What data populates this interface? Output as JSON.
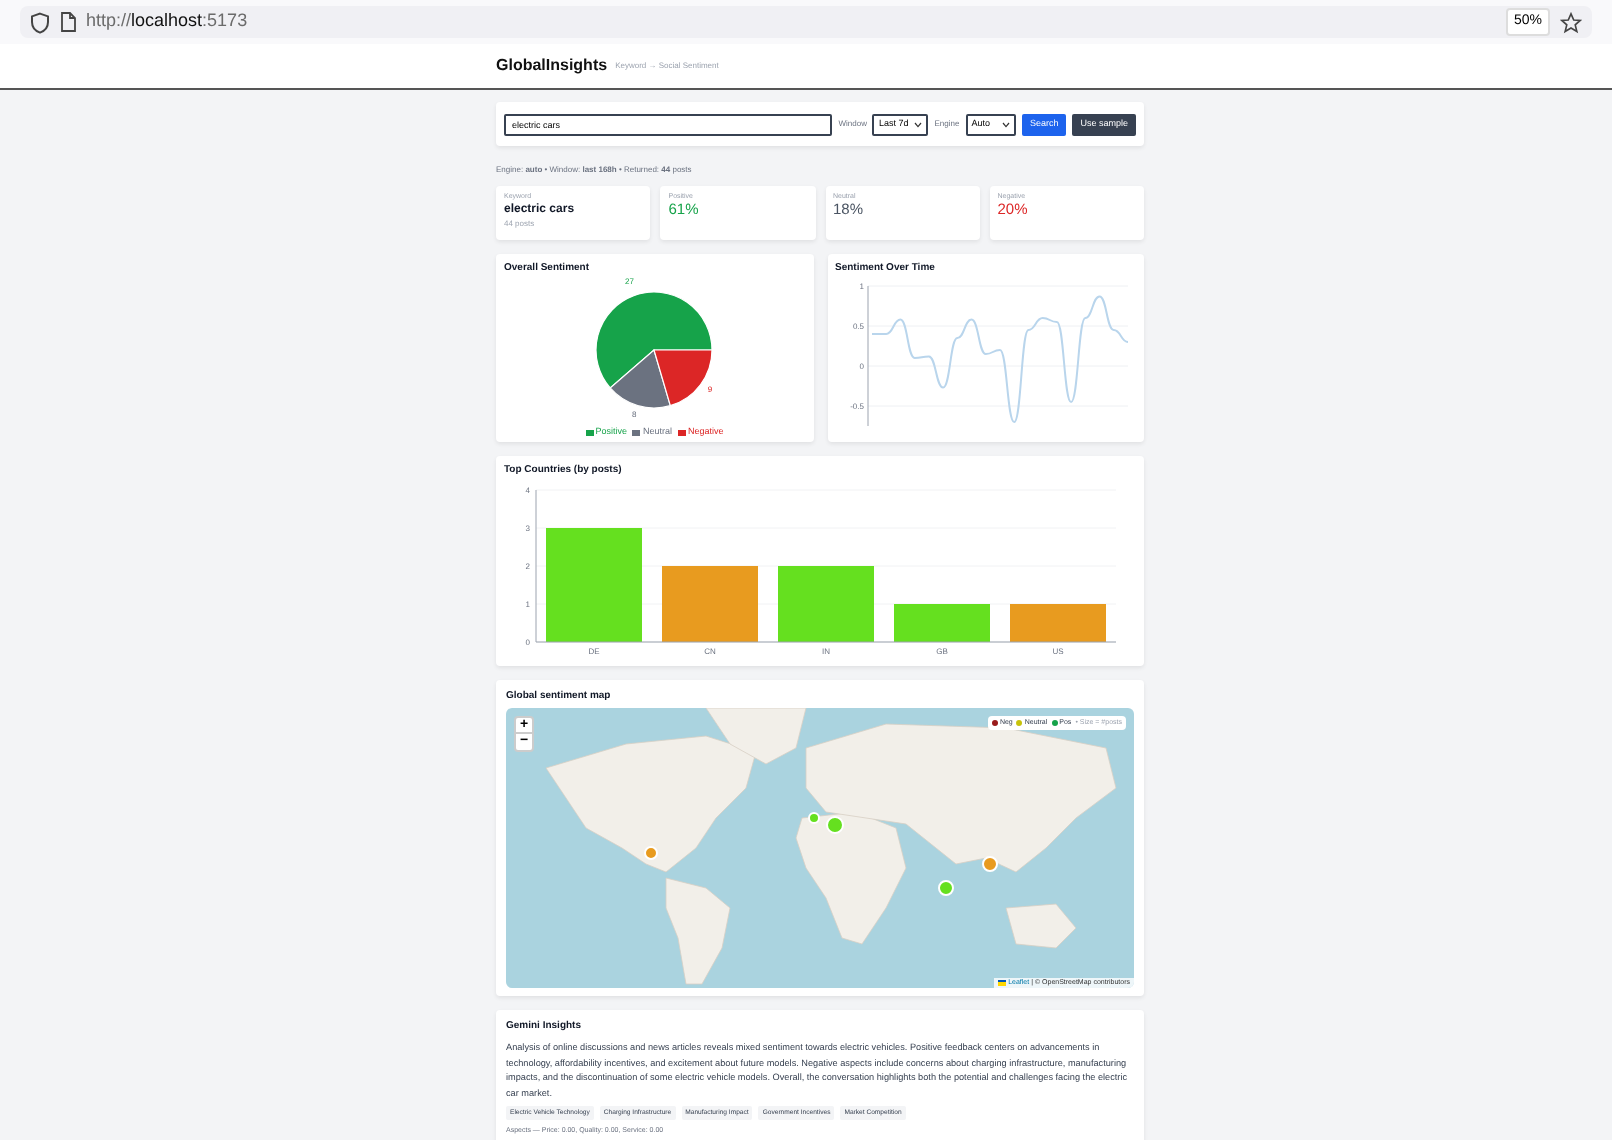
{
  "browser": {
    "url_scheme": "http://",
    "url_host": "localhost",
    "url_port": ":5173",
    "zoom": "50%"
  },
  "header": {
    "brand": "GlobalInsights",
    "tagline": "Keyword → Social Sentiment"
  },
  "search": {
    "value": "electric cars",
    "window_label": "Window",
    "window_value": "Last 7d",
    "engine_label": "Engine",
    "engine_value": "Auto",
    "buttons": [
      {
        "label": "Search",
        "kind": "primary"
      },
      {
        "label": "Use sample",
        "kind": "secondary"
      }
    ]
  },
  "summary": "Engine: **auto** • Window: **last 168h** • Returned: **44** posts",
  "stats": [
    {
      "label": "Keyword",
      "value": "electric cars",
      "note": "44 posts",
      "color": "#111827"
    },
    {
      "label": "Positive",
      "value": "61%",
      "color": "#16a34a"
    },
    {
      "label": "Neutral",
      "value": "18%",
      "color": "#4b5563"
    },
    {
      "label": "Negative",
      "value": "20%",
      "color": "#dc2626"
    }
  ],
  "overall": {
    "title": "Overall Sentiment",
    "chart_data": {
      "type": "pie",
      "categories": [
        "Positive",
        "Neutral",
        "Negative"
      ],
      "colors": [
        "#16a34a",
        "#6b7280",
        "#dc2626"
      ],
      "values": [
        27,
        8,
        9
      ],
      "data_labels": true,
      "legend": true
    }
  },
  "over_time": {
    "title": "Sentiment Over Time",
    "chart_data": {
      "type": "line",
      "ylim": [
        -0.75,
        1
      ],
      "yticks": [
        -0.5,
        0,
        0.5,
        1
      ],
      "grid": true,
      "series": [
        {
          "color": "#b9d5ec",
          "values": [
            0.4,
            0.4,
            0.58,
            0.1,
            0.12,
            -0.27,
            0.35,
            0.58,
            0.15,
            0.2,
            -0.7,
            0.45,
            0.6,
            0.55,
            -0.45,
            0.6,
            0.87,
            0.45,
            0.3
          ]
        }
      ]
    }
  },
  "countries": {
    "title": "Top Countries (by posts)",
    "chart_data": {
      "type": "bar",
      "categories": [
        "DE",
        "CN",
        "IN",
        "GB",
        "US"
      ],
      "ylim": [
        0,
        4
      ],
      "yticks": [
        0,
        1,
        2,
        3,
        4
      ],
      "grid": true,
      "stacked": true,
      "series": [
        {
          "color": "#65e01f",
          "values": [
            3,
            null,
            2,
            1,
            null
          ]
        },
        {
          "color": "#e89b1f",
          "values": [
            null,
            2,
            null,
            null,
            1
          ]
        }
      ]
    }
  },
  "map": {
    "title": "Global sentiment map",
    "zoom_in": "+",
    "zoom_out": "−",
    "legend": [
      {
        "label": "Neg",
        "color": "#991b1b"
      },
      {
        "label": "Neutral",
        "color": "#c7c20a"
      },
      {
        "label": "Pos",
        "color": "#16a34a"
      }
    ],
    "legend_note": "• Size = #posts",
    "markers": [
      {
        "color": "#e89b1f"
      },
      {
        "color": "#65e01f"
      },
      {
        "color": "#65e01f"
      },
      {
        "color": "#65e01f"
      },
      {
        "color": "#e89b1f"
      }
    ],
    "attribution_link": "Leaflet",
    "attribution": "| © OpenStreetMap contributors"
  },
  "insights": {
    "title": "Gemini Insights",
    "text": "Analysis of online discussions and news articles reveals mixed sentiment towards electric vehicles. Positive feedback centers on advancements in technology, affordability incentives, and excitement about future models. Negative aspects include concerns about charging infrastructure, manufacturing impacts, and the discontinuation of some electric vehicle models. Overall, the conversation highlights both the potential and challenges facing the electric car market.",
    "tags": [
      "Electric Vehicle Technology",
      "Charging Infrastructure",
      "Manufacturing Impact",
      "Government Incentives",
      "Market Competition"
    ],
    "aspects": "Aspects — Price: 0.00, Quality: 0.00, Service: 0.00"
  }
}
